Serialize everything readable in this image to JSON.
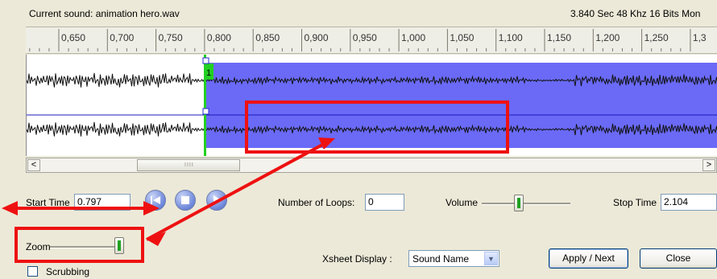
{
  "header": {
    "current_sound": "Current sound: animation hero.wav",
    "sound_info": "3.840 Sec 48 Khz 16 Bits Mon"
  },
  "ruler": {
    "ticks": [
      "0,650",
      "0,700",
      "0,750",
      "0,800",
      "0,850",
      "0,900",
      "0,950",
      "1,000",
      "1,050",
      "1,100",
      "1,150",
      "1,200",
      "1,250",
      "1,3"
    ]
  },
  "waveform": {
    "playhead_label": "1",
    "selection_start": 0.797,
    "selection_color": "#6a6af7",
    "playhead_color": "#22d022"
  },
  "scrollbar": {
    "left_arrow": "<",
    "right_arrow": ">",
    "grip": "IIII"
  },
  "controls": {
    "start_time_label": "Start Time",
    "start_time_value": "0.797",
    "loops_label": "Number of Loops:",
    "loops_value": "0",
    "volume_label": "Volume",
    "volume_level": 0.42,
    "stop_time_label": "Stop Time",
    "stop_time_value": "2.104",
    "zoom_label": "Zoom",
    "zoom_level": 0.95,
    "scrubbing_label": "Scrubbing",
    "xsheet_label": "Xsheet Display :",
    "xsheet_value": "Sound Name",
    "apply_next_label": "Apply / Next",
    "close_label": "Close"
  },
  "playback": {
    "rewind_icon": "rewind-icon",
    "stop_icon": "stop-icon",
    "play_icon": "play-icon"
  },
  "annotation_color": "#ee1111"
}
